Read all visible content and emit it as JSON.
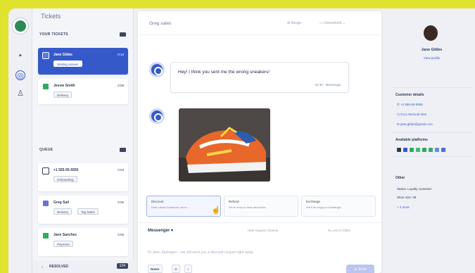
{
  "tickets_panel": {
    "title": "Tickets",
    "sections": [
      {
        "label": "YOUR TICKETS",
        "items": [
          {
            "name": "Jane Gibbs",
            "time": "0:13",
            "tags": [
              "Waiting answer"
            ],
            "active": true
          },
          {
            "name": "Jessie Smith",
            "time": "0:08",
            "tags": [
              "Delivery"
            ],
            "active": false
          }
        ]
      },
      {
        "label": "QUEUE",
        "items": [
          {
            "name": "+1 555-55-5555",
            "time": "0:03",
            "tags": [
              "Onboarding"
            ]
          },
          {
            "name": "Greg Sail",
            "time": "0:05",
            "tags": [
              "Delivery",
              "Tag Sales"
            ]
          },
          {
            "name": "Jane Sanchez",
            "time": "0:06",
            "tags": [
              "Payment"
            ]
          }
        ]
      }
    ],
    "footer": {
      "label": "RESOLVED",
      "count": "124"
    }
  },
  "chat": {
    "contact": "Greg sales",
    "actions": [
      "Assign",
      "Unresolved"
    ],
    "message": "Hey! I think you sent me the wrong sneakers!",
    "message_meta": "02:30 · Messenger",
    "templates": [
      {
        "title": "Discount",
        "desc": "Dear valued customer, we're...",
        "selected": true
      },
      {
        "title": "Refund",
        "desc": "We're sorry to hear about this...",
        "selected": false
      },
      {
        "title": "Exchange",
        "desc": "We'll be happy to exchange...",
        "selected": false
      }
    ],
    "channel": "Messenger ▾",
    "channel_right": [
      "Hide Support channel",
      "No use in Gibbs"
    ],
    "placeholder": "Hi Jane, Apologies – we will send you a discount coupon right away.",
    "bottom_buttons": [
      "Notes",
      "⊘",
      "+"
    ],
    "send": "Send"
  },
  "profile": {
    "name": "Jane Gibbs",
    "link": "View profile",
    "details_title": "Customer details",
    "details": [
      "+1 555-55-5555",
      "9:14 AM local time",
      "jane.gibbs@gmail.com"
    ],
    "platforms_title": "Available platforms",
    "platform_colors": [
      "#2b3a55",
      "#3659c9",
      "#2faa5e",
      "#34c36a",
      "#2faa5e",
      "#3aa86a",
      "#6d8bd8",
      "#4d6fd1"
    ],
    "other_title": "Other",
    "other": [
      "Status: Loyalty customer",
      "Shoe size: 38"
    ],
    "more": "+ 3 more"
  }
}
